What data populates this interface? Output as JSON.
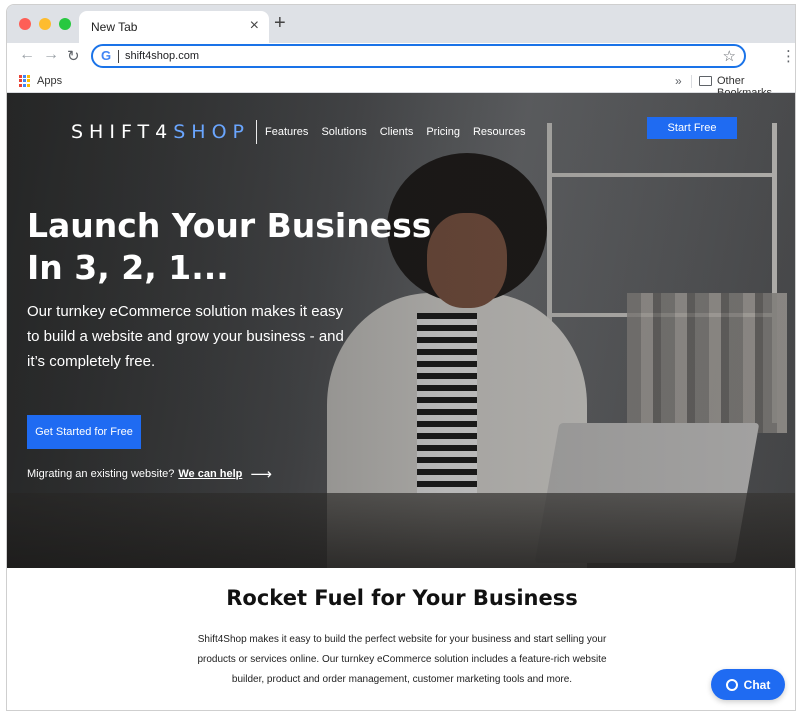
{
  "browser": {
    "tab_title": "New Tab",
    "tab_close": "×",
    "new_tab": "+",
    "url": "shift4shop.com",
    "bookmarks": {
      "apps_label": "Apps",
      "more": "»",
      "other_bookmarks": "Other Bookmarks"
    }
  },
  "site": {
    "logo_text_main": "SHIFT4",
    "logo_text_accent": "SHOP",
    "nav": [
      "Features",
      "Solutions",
      "Clients",
      "Pricing",
      "Resources"
    ],
    "start_free_label": "Start Free",
    "headline_line1": "Launch Your Business",
    "headline_line2": "In 3, 2, 1...",
    "subtext": "Our turnkey eCommerce solution makes it easy to build a website and grow your business - and it’s completely free.",
    "cta_label": "Get Started for Free",
    "migrate_text": "Migrating an existing website?",
    "migrate_link": "We can help",
    "section_title": "Rocket Fuel for Your Business",
    "section_body": "Shift4Shop makes it easy to build the perfect website for your business and start selling your products or services online. Our turnkey eCommerce solution includes a feature-rich website builder, product and order management, customer marketing tools and more.",
    "chat_label": "Chat"
  },
  "colors": {
    "accent": "#1f6bf2",
    "logo_accent": "#6aa6ff",
    "omnibox_focus": "#1a73e8"
  }
}
